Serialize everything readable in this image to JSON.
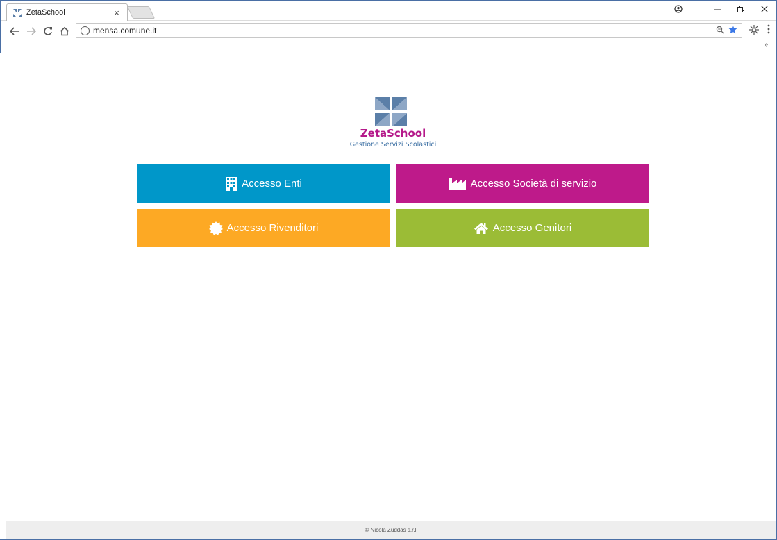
{
  "browser": {
    "tab_title": "ZetaSchool",
    "tab_close": "×",
    "url": "mensa.comune.it",
    "bookmark_more": "»",
    "icons": {
      "back": "arrow-left-icon",
      "forward": "arrow-right-icon",
      "reload": "reload-icon",
      "home": "home-icon",
      "info": "info-icon",
      "zoom": "zoom-icon",
      "bookmark": "star-icon",
      "extension": "extension-icon",
      "menu": "kebab-menu-icon",
      "profile": "profile-icon"
    },
    "colors": {
      "star": "#3b78e7"
    }
  },
  "brand": {
    "name": "ZetaSchool",
    "tagline": "Gestione Servizi Scolastici",
    "colors": {
      "name": "#b5198a",
      "tagline": "#3b6fa3",
      "logo": "#5b7fa8"
    }
  },
  "tiles": [
    {
      "label": "Accesso Enti",
      "icon": "building-icon",
      "color": "#0097c9"
    },
    {
      "label": "Accesso Società di servizio",
      "icon": "factory-icon",
      "color": "#be1a8a"
    },
    {
      "label": "Accesso Rivenditori",
      "icon": "certificate-icon",
      "color": "#fda924"
    },
    {
      "label": "Accesso Genitori",
      "icon": "home-icon",
      "color": "#9bbc36"
    }
  ],
  "footer": {
    "text": "© Nicola Zuddas s.r.l."
  }
}
